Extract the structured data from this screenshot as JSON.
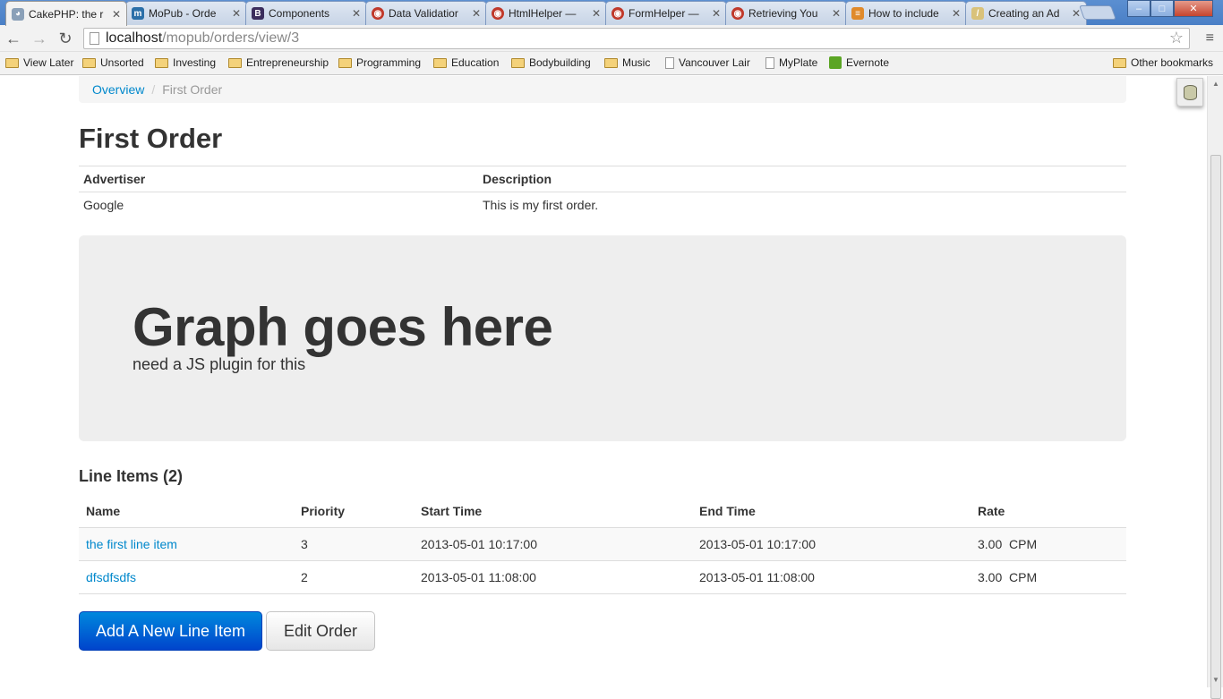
{
  "browser": {
    "tabs": [
      {
        "title": "CakePHP: the r",
        "icon": "cakephp-icon",
        "active": true
      },
      {
        "title": "MoPub - Orde",
        "icon": "mopub-icon"
      },
      {
        "title": "Components",
        "icon": "bootstrap-icon"
      },
      {
        "title": "Data Validatior",
        "icon": "cakephp-icon"
      },
      {
        "title": "HtmlHelper —",
        "icon": "cakephp-icon"
      },
      {
        "title": "FormHelper —",
        "icon": "cakephp-icon"
      },
      {
        "title": "Retrieving You",
        "icon": "cakephp-icon"
      },
      {
        "title": "How to include",
        "icon": "stackoverflow-icon"
      },
      {
        "title": "Creating an Ad",
        "icon": "document-icon"
      }
    ],
    "window_controls": {
      "minimize": "–",
      "maximize": "□",
      "close": "✕"
    },
    "url": {
      "host": "localhost",
      "path": "/mopub/orders/view/3"
    },
    "bookmarks": [
      {
        "label": "View Later",
        "icon": "folder-icon"
      },
      {
        "label": "Unsorted",
        "icon": "folder-icon"
      },
      {
        "label": "Investing",
        "icon": "folder-icon"
      },
      {
        "label": "Entrepreneurship",
        "icon": "folder-icon"
      },
      {
        "label": "Programming",
        "icon": "folder-icon"
      },
      {
        "label": "Education",
        "icon": "folder-icon"
      },
      {
        "label": "Bodybuilding",
        "icon": "folder-icon"
      },
      {
        "label": "Music",
        "icon": "folder-icon"
      },
      {
        "label": "Vancouver Lair",
        "icon": "page-icon"
      },
      {
        "label": "MyPlate",
        "icon": "page-icon"
      },
      {
        "label": "Evernote",
        "icon": "evernote-icon"
      }
    ],
    "other_bookmarks": "Other bookmarks"
  },
  "breadcrumb": {
    "overview": "Overview",
    "separator": "/",
    "current": "First Order"
  },
  "page": {
    "title": "First Order",
    "info_headers": {
      "advertiser": "Advertiser",
      "description": "Description"
    },
    "info_values": {
      "advertiser": "Google",
      "description": "This is my first order."
    }
  },
  "hero": {
    "heading": "Graph goes here",
    "subtext": "need a JS plugin for this"
  },
  "line_items": {
    "title": "Line Items (2)",
    "columns": [
      "Name",
      "Priority",
      "Start Time",
      "End Time",
      "Rate"
    ],
    "rows": [
      {
        "name": "the first line item",
        "priority": "3",
        "start": "2013-05-01 10:17:00",
        "end": "2013-05-01 10:17:00",
        "rate": "3.00  CPM"
      },
      {
        "name": "dfsdfsdfs",
        "priority": "2",
        "start": "2013-05-01 11:08:00",
        "end": "2013-05-01 11:08:00",
        "rate": "3.00  CPM"
      }
    ]
  },
  "actions": {
    "add": "Add A New Line Item",
    "edit": "Edit Order"
  },
  "colors": {
    "link": "#0088cc",
    "primary_button": "#0055cc",
    "hero_bg": "#eeeeee"
  }
}
